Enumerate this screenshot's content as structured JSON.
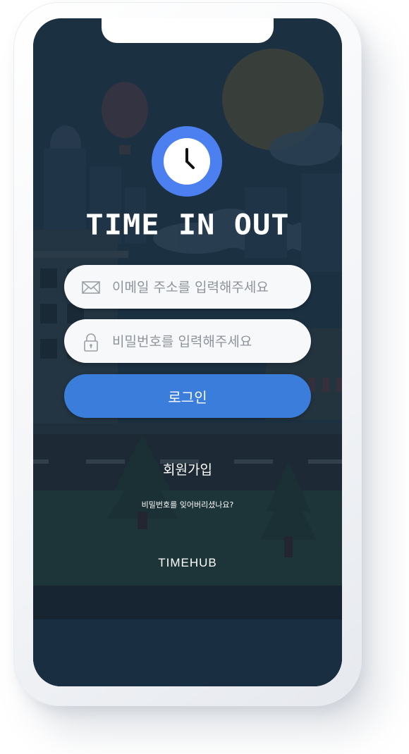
{
  "app": {
    "title": "TIME IN OUT",
    "brand": "TIMEHUB"
  },
  "login_form": {
    "email_placeholder": "이메일 주소를 입력해주세요",
    "password_placeholder": "비밀번호를 입력해주세요",
    "login_label": "로그인"
  },
  "links": {
    "signup": "회원가입",
    "forgot_password": "비밀번호를 잊어버리셨나요?"
  },
  "icons": {
    "logo": "clock-icon",
    "email": "envelope-icon",
    "password": "lock-icon"
  },
  "colors": {
    "accent": "#3a7ddb",
    "logo_circle": "#4c7ff0",
    "background": "#1d3244"
  }
}
